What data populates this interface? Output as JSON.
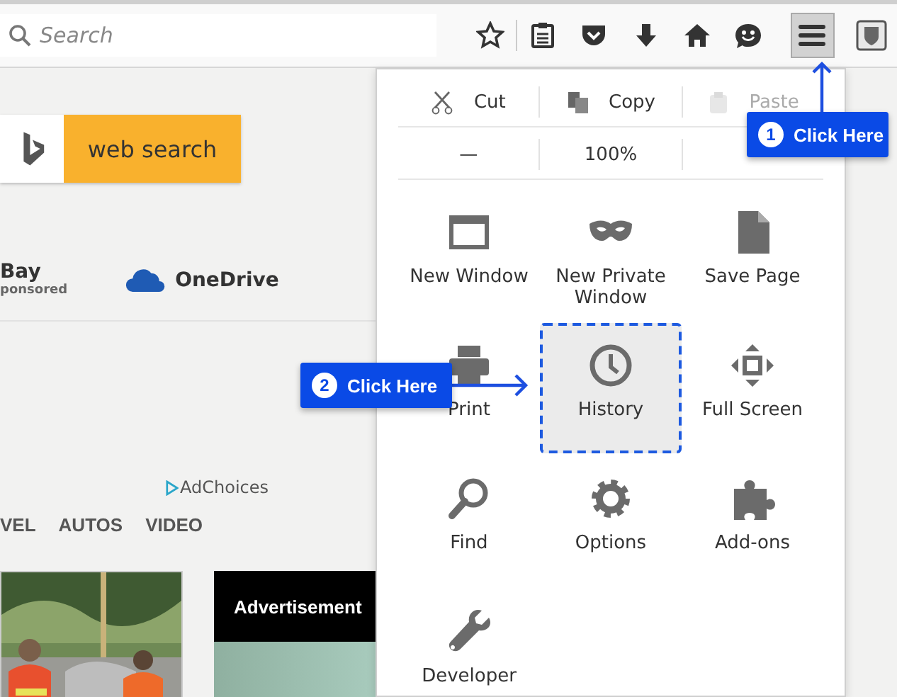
{
  "toolbar": {
    "search": {
      "placeholder": "Search"
    },
    "menu_button": {
      "open": true
    }
  },
  "page": {
    "search_button": "web search",
    "sites": [
      {
        "kind": "text",
        "name": "Bay",
        "note": "ponsored"
      },
      {
        "kind": "cloud",
        "name": "OneDrive"
      }
    ],
    "ad_choices": "AdChoices",
    "nav": [
      "VEL",
      "AUTOS",
      "VIDEO"
    ],
    "tiles": [
      {
        "kind": "picture"
      },
      {
        "kind": "ad",
        "title": "Advertisement"
      }
    ]
  },
  "menu": {
    "edit": [
      {
        "kind": "cut",
        "label": "Cut",
        "disabled": false
      },
      {
        "kind": "copy",
        "label": "Copy",
        "disabled": false
      },
      {
        "kind": "paste",
        "label": "Paste",
        "disabled": true
      }
    ],
    "zoom": {
      "zoom_out": "—",
      "level": "100%"
    },
    "items": [
      {
        "kind": "new-window",
        "label": "New Window",
        "selected": false
      },
      {
        "kind": "private",
        "label": "New Private Window",
        "selected": false
      },
      {
        "kind": "save",
        "label": "Save Page",
        "selected": false
      },
      {
        "kind": "print",
        "label": "Print",
        "selected": false
      },
      {
        "kind": "history",
        "label": "History",
        "selected": true
      },
      {
        "kind": "fullscreen",
        "label": "Full Screen",
        "selected": false
      },
      {
        "kind": "find",
        "label": "Find",
        "selected": false
      },
      {
        "kind": "options",
        "label": "Options",
        "selected": false
      },
      {
        "kind": "addons",
        "label": "Add-ons",
        "selected": false
      },
      {
        "kind": "developer",
        "label": "Developer",
        "selected": false
      }
    ]
  },
  "callouts": [
    {
      "kind": "up",
      "number": "1",
      "text": "Click Here"
    },
    {
      "kind": "right",
      "number": "2",
      "text": "Click Here"
    }
  ]
}
